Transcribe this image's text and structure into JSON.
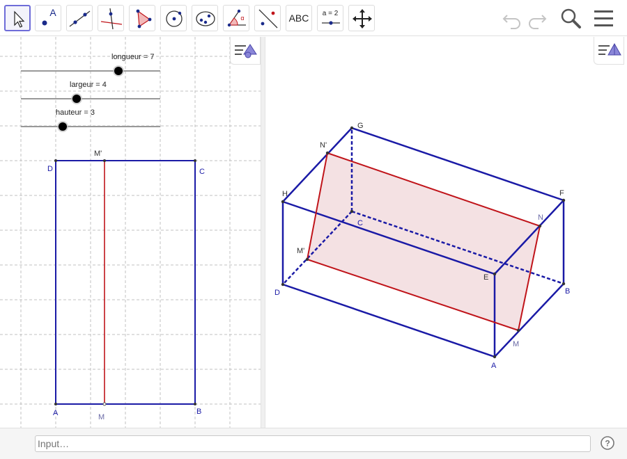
{
  "toolbar": {
    "tools": [
      {
        "name": "move-tool",
        "icon": "pointer-arrow-icon"
      },
      {
        "name": "point-tool",
        "icon": "point-icon",
        "label": "A"
      },
      {
        "name": "line-tool",
        "icon": "line-through-two-points-icon"
      },
      {
        "name": "perpendicular-line-tool",
        "icon": "perpendicular-line-icon"
      },
      {
        "name": "polygon-tool",
        "icon": "polygon-icon"
      },
      {
        "name": "circle-tool",
        "icon": "circle-with-center-icon"
      },
      {
        "name": "conic-tool",
        "icon": "ellipse-icon"
      },
      {
        "name": "angle-tool",
        "icon": "angle-icon",
        "label": "α"
      },
      {
        "name": "reflect-tool",
        "icon": "reflect-about-line-icon"
      },
      {
        "name": "text-tool",
        "icon": "text-icon",
        "label": "ABC"
      },
      {
        "name": "slider-tool",
        "icon": "slider-icon",
        "label": "a = 2"
      },
      {
        "name": "move-graphics-view-tool",
        "icon": "move-cross-arrows-icon"
      }
    ],
    "undo_icon": "undo-icon",
    "redo_icon": "redo-icon",
    "search_icon": "search-icon",
    "menu_icon": "hamburger-menu-icon"
  },
  "sliders": [
    {
      "name": "longueur",
      "label": "longueur = 7",
      "value": 7
    },
    {
      "name": "largeur",
      "label": "largeur = 4",
      "value": 4
    },
    {
      "name": "hauteur",
      "label": "hauteur = 3",
      "value": 3
    }
  ],
  "left_view": {
    "points": {
      "A": "A",
      "B": "B",
      "C": "C",
      "D": "D",
      "M": "M",
      "Mp": "M'"
    }
  },
  "view3d": {
    "points": {
      "A": "A",
      "B": "B",
      "C": "C",
      "D": "D",
      "E": "E",
      "F": "F",
      "G": "G",
      "H": "H",
      "M": "M",
      "N": "N",
      "Np": "N'",
      "Mp": "M'"
    }
  },
  "input_bar": {
    "placeholder": "Input…"
  },
  "colors": {
    "edge_blue": "#1a1aa6",
    "section_red": "#c0141a",
    "section_fill": "#f3dfe1",
    "label_blue": "#2b2bcf",
    "selected_tool_border": "#6e6cd8"
  },
  "stylebar_icon": "graphics-stylebar-icon",
  "stylebar_icon_3d": "3d-stylebar-icon",
  "help_icon": "help-icon"
}
